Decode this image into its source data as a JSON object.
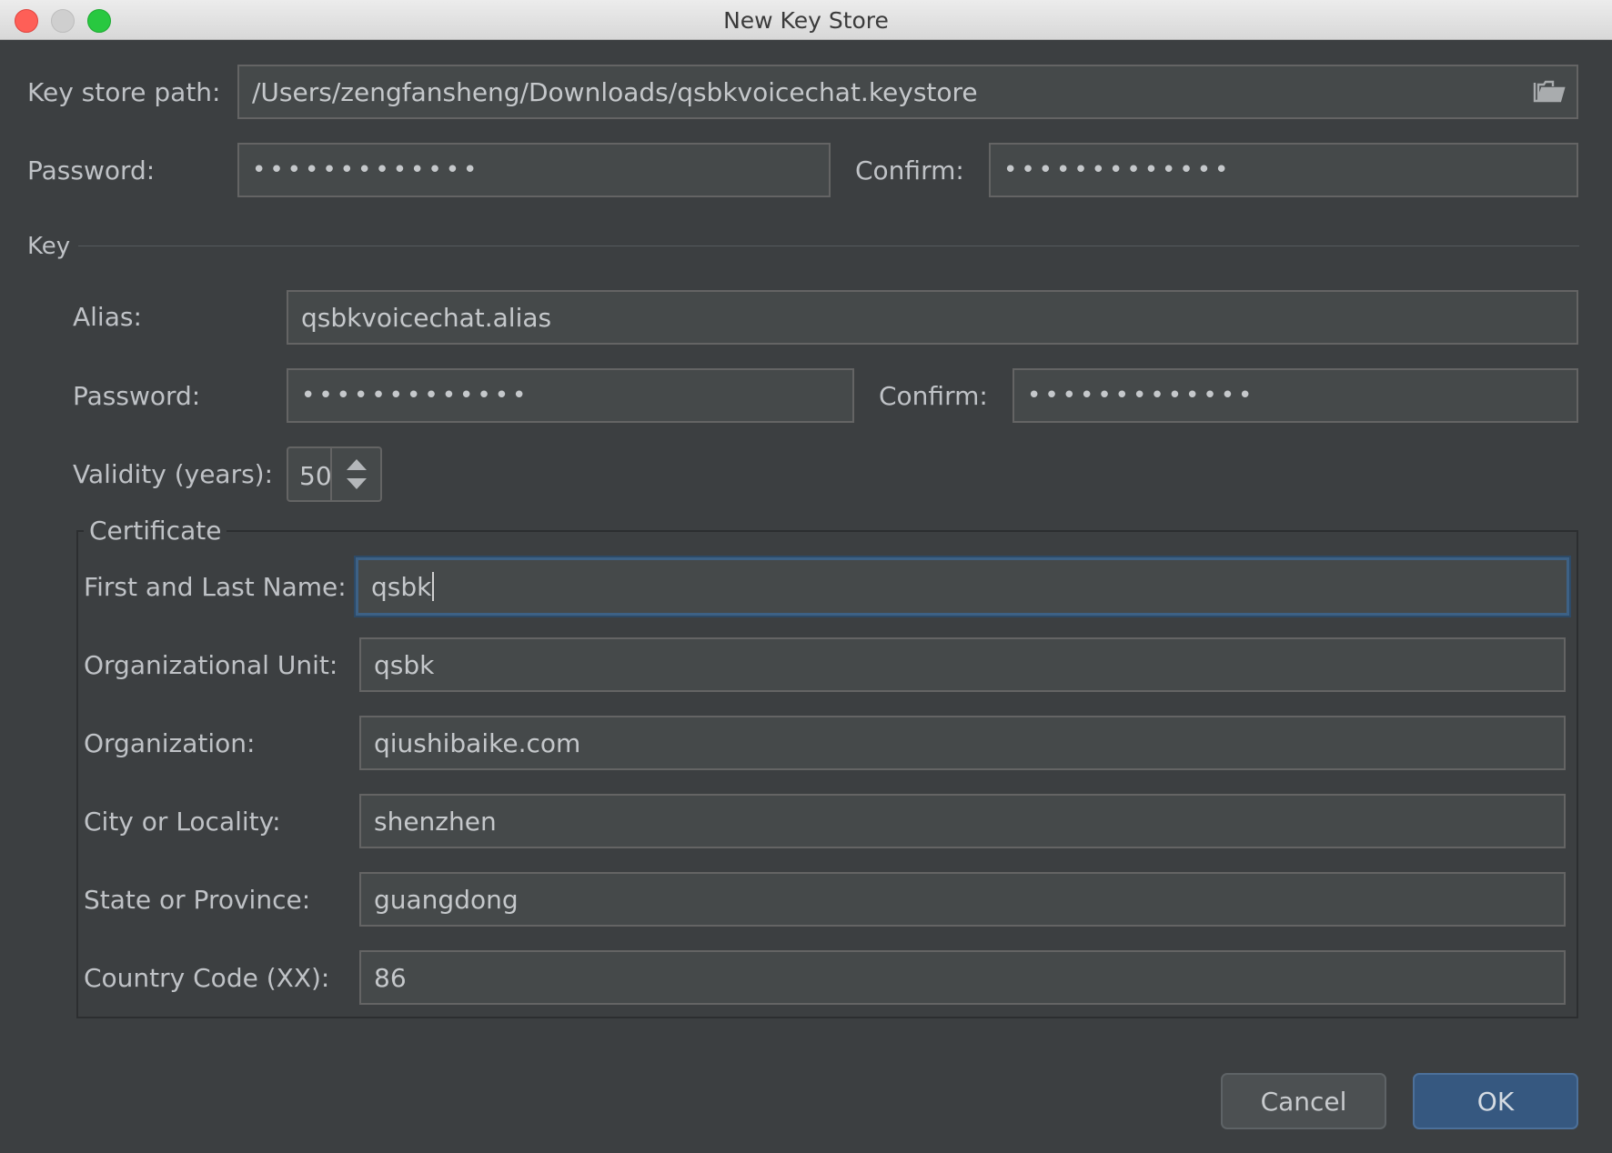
{
  "window": {
    "title": "New Key Store"
  },
  "keystore": {
    "path_label": "Key store path:",
    "path_value": "/Users/zengfansheng/Downloads/qsbkvoicechat.keystore",
    "password_label": "Password:",
    "password_value": "•••••••••••••",
    "confirm_label": "Confirm:",
    "confirm_value": "•••••••••••••"
  },
  "key": {
    "section_label": "Key",
    "alias_label": "Alias:",
    "alias_value": "qsbkvoicechat.alias",
    "password_label": "Password:",
    "password_value": "•••••••••••••",
    "confirm_label": "Confirm:",
    "confirm_value": "•••••••••••••",
    "validity_label": "Validity (years):",
    "validity_value": "50"
  },
  "certificate": {
    "section_label": "Certificate",
    "fields": [
      {
        "label": "First and Last Name:",
        "value": "qsbk"
      },
      {
        "label": "Organizational Unit:",
        "value": "qsbk"
      },
      {
        "label": "Organization:",
        "value": "qiushibaike.com"
      },
      {
        "label": "City or Locality:",
        "value": "shenzhen"
      },
      {
        "label": "State or Province:",
        "value": "guangdong"
      },
      {
        "label": "Country Code (XX):",
        "value": "86"
      }
    ]
  },
  "buttons": {
    "cancel": "Cancel",
    "ok": "OK"
  },
  "colors": {
    "accent": "#365880",
    "focus_border": "#3d6185",
    "background": "#3c3f41"
  }
}
